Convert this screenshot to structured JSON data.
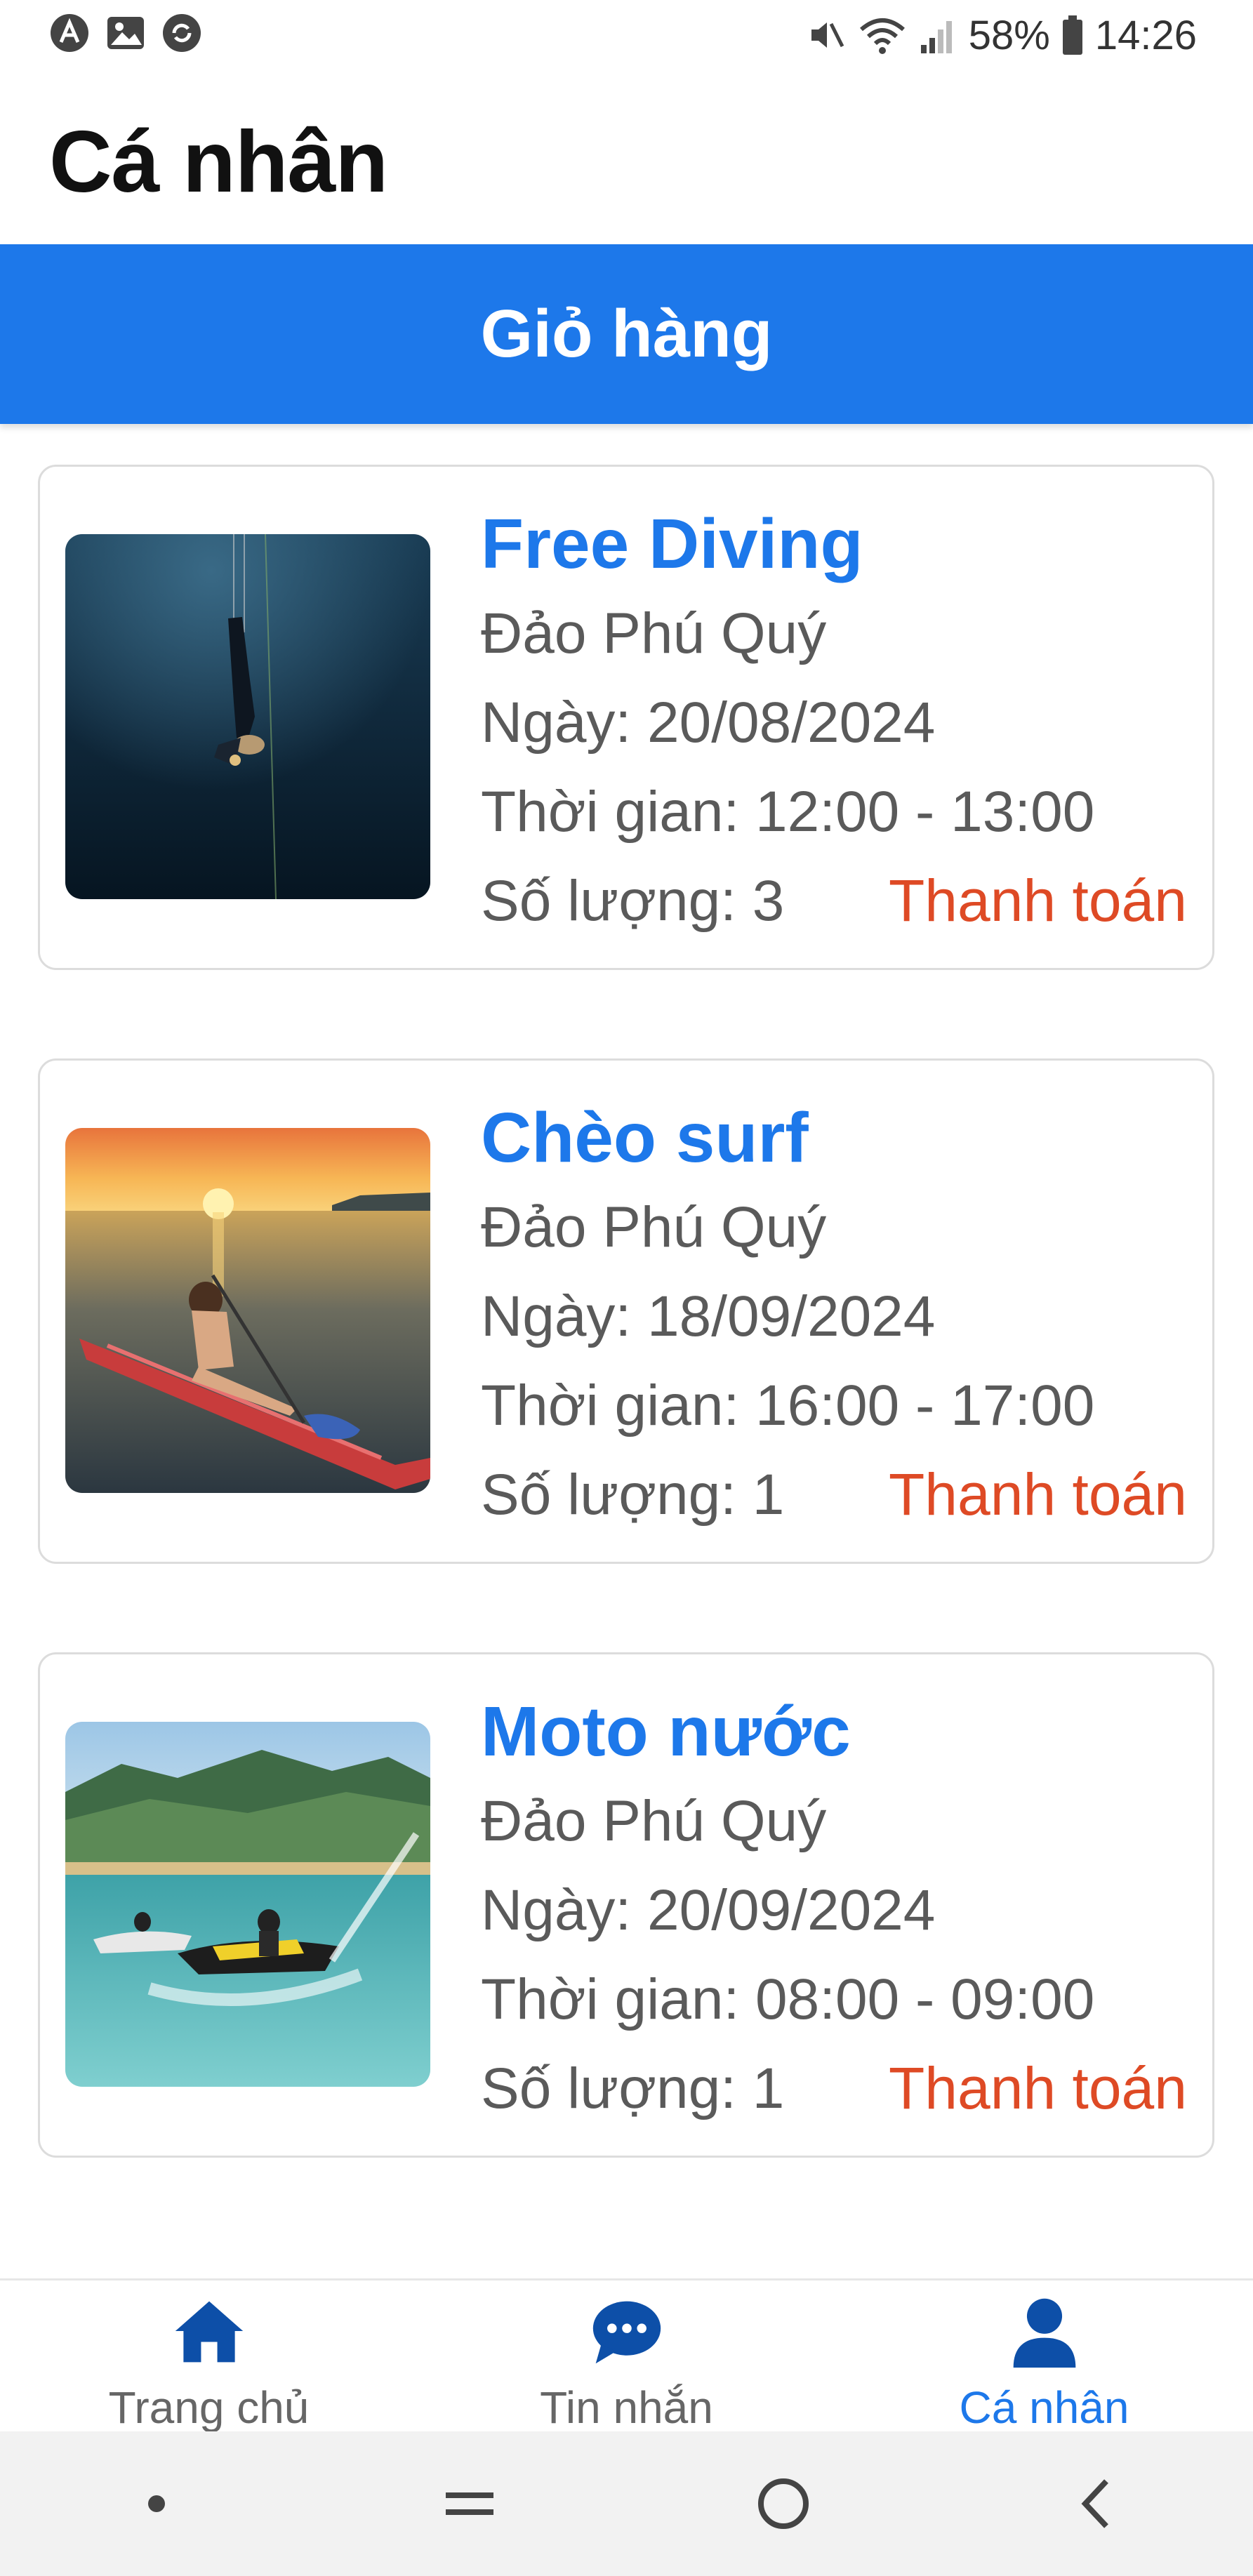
{
  "status_bar": {
    "battery": "58%",
    "time": "14:26",
    "icons": [
      "a-app-icon",
      "gallery-icon",
      "sync-app-icon",
      "mute-icon",
      "wifi-icon",
      "signal-icon",
      "battery-icon"
    ]
  },
  "header": {
    "title": "Cá nhân"
  },
  "cart": {
    "title": "Giỏ hàng",
    "items": [
      {
        "title": "Free Diving",
        "location": "Đảo Phú Quý",
        "date": "Ngày: 20/08/2024",
        "time": "Thời gian: 12:00 - 13:00",
        "quantity": "Số lượng: 3",
        "action": "Thanh toán",
        "image": "free-diving-photo"
      },
      {
        "title": "Chèo surf",
        "location": "Đảo Phú Quý",
        "date": "Ngày: 18/09/2024",
        "time": "Thời gian: 16:00 - 17:00",
        "quantity": "Số lượng: 1",
        "action": "Thanh toán",
        "image": "paddle-surf-photo"
      },
      {
        "title": "Moto nước",
        "location": "Đảo Phú Quý",
        "date": "Ngày: 20/09/2024",
        "time": "Thời gian: 08:00 - 09:00",
        "quantity": "Số lượng: 1",
        "action": "Thanh toán",
        "image": "jet-ski-photo"
      }
    ]
  },
  "bottom_nav": {
    "items": [
      {
        "label": "Trang chủ",
        "icon": "home-icon"
      },
      {
        "label": "Tin nhắn",
        "icon": "chat-icon"
      },
      {
        "label": "Cá nhân",
        "icon": "person-icon",
        "active": true
      }
    ]
  },
  "colors": {
    "primary": "#1d78ea",
    "action": "#de4a25",
    "nav_icon": "#0d4fa8"
  }
}
